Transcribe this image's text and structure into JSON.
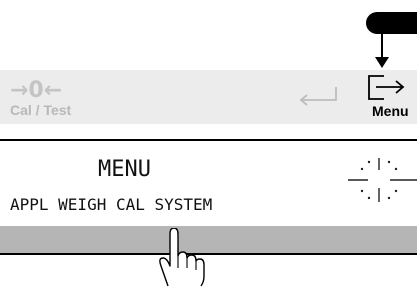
{
  "key_strip": {
    "zero_symbol": "→0←",
    "cal_test_label": "Cal / Test",
    "menu_label": "Menu"
  },
  "display": {
    "title": "MENU",
    "options": "APPL WEIGH CAL SYSTEM"
  },
  "icons": {
    "zero": "zero-arrows-icon",
    "enter": "enter-return-icon",
    "menu": "menu-exit-icon",
    "indicator_arrow": "down-arrow-icon",
    "pointer": "hand-pointer-icon",
    "crosshair": "crosshair-icon"
  },
  "colors": {
    "key_strip_bg": "#ececec",
    "softkey_bar": "#b5b5b5",
    "inactive_text": "#bcbcbc",
    "active_text": "#000000"
  }
}
